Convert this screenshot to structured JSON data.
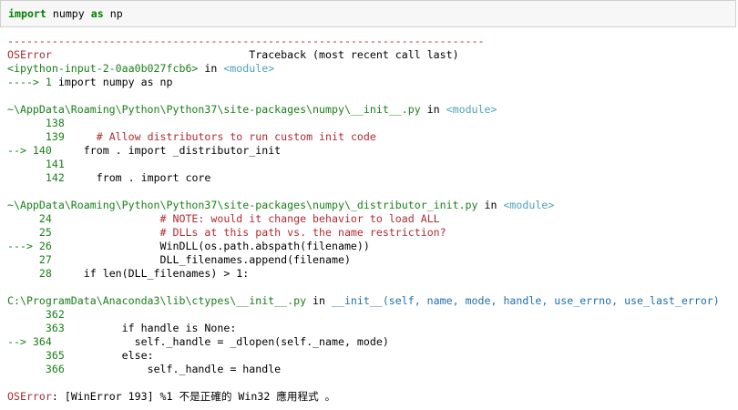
{
  "input_cell": {
    "kw_import": "import",
    "module": " numpy ",
    "kw_as": "as",
    "alias": " np"
  },
  "traceback": {
    "separator": "---------------------------------------------------------------------------",
    "error_type": "OSError",
    "header_right": "                               Traceback (most recent call last)",
    "frames": [
      {
        "location": "<ipython-input-2-0aa0b027fcb6>",
        "in_word": " in ",
        "func": "<module>",
        "lines": [
          {
            "arrow": "----> ",
            "num": "1",
            "code": " import numpy as np"
          }
        ]
      },
      {
        "location": "~\\AppData\\Roaming\\Python\\Python37\\site-packages\\numpy\\__init__.py",
        "in_word": " in ",
        "func": "<module>",
        "lines": [
          {
            "arrow": "      ",
            "num": "138",
            "code": ""
          },
          {
            "arrow": "      ",
            "num": "139",
            "code": "     # Allow distributors to run custom init code"
          },
          {
            "arrow": "--> ",
            "num": "140",
            "code": "     from . import _distributor_init"
          },
          {
            "arrow": "      ",
            "num": "141",
            "code": ""
          },
          {
            "arrow": "      ",
            "num": "142",
            "code": "     from . import core"
          }
        ]
      },
      {
        "location": "~\\AppData\\Roaming\\Python\\Python37\\site-packages\\numpy\\_distributor_init.py",
        "in_word": " in ",
        "func": "<module>",
        "lines": [
          {
            "arrow": "     ",
            "num": "24",
            "code": "                 # NOTE: would it change behavior to load ALL"
          },
          {
            "arrow": "     ",
            "num": "25",
            "code": "                 # DLLs at this path vs. the name restriction?"
          },
          {
            "arrow": "---> ",
            "num": "26",
            "code": "                 WinDLL(os.path.abspath(filename))"
          },
          {
            "arrow": "     ",
            "num": "27",
            "code": "                 DLL_filenames.append(filename)"
          },
          {
            "arrow": "     ",
            "num": "28",
            "code": "     if len(DLL_filenames) > 1:"
          }
        ]
      },
      {
        "location": "C:\\ProgramData\\Anaconda3\\lib\\ctypes\\__init__.py",
        "in_word": " in ",
        "func": "__init__(self, name, mode, handle, use_errno, use_last_error)",
        "lines": [
          {
            "arrow": "      ",
            "num": "362",
            "code": ""
          },
          {
            "arrow": "      ",
            "num": "363",
            "code": "         if handle is None:"
          },
          {
            "arrow": "--> ",
            "num": "364",
            "code": "             self._handle = _dlopen(self._name, mode)"
          },
          {
            "arrow": "      ",
            "num": "365",
            "code": "         else:"
          },
          {
            "arrow": "      ",
            "num": "366",
            "code": "             self._handle = handle"
          }
        ]
      }
    ],
    "final_error_type": "OSError",
    "final_error_message": ": [WinError 193] %1 不是正確的 Win32 應用程式 。"
  }
}
